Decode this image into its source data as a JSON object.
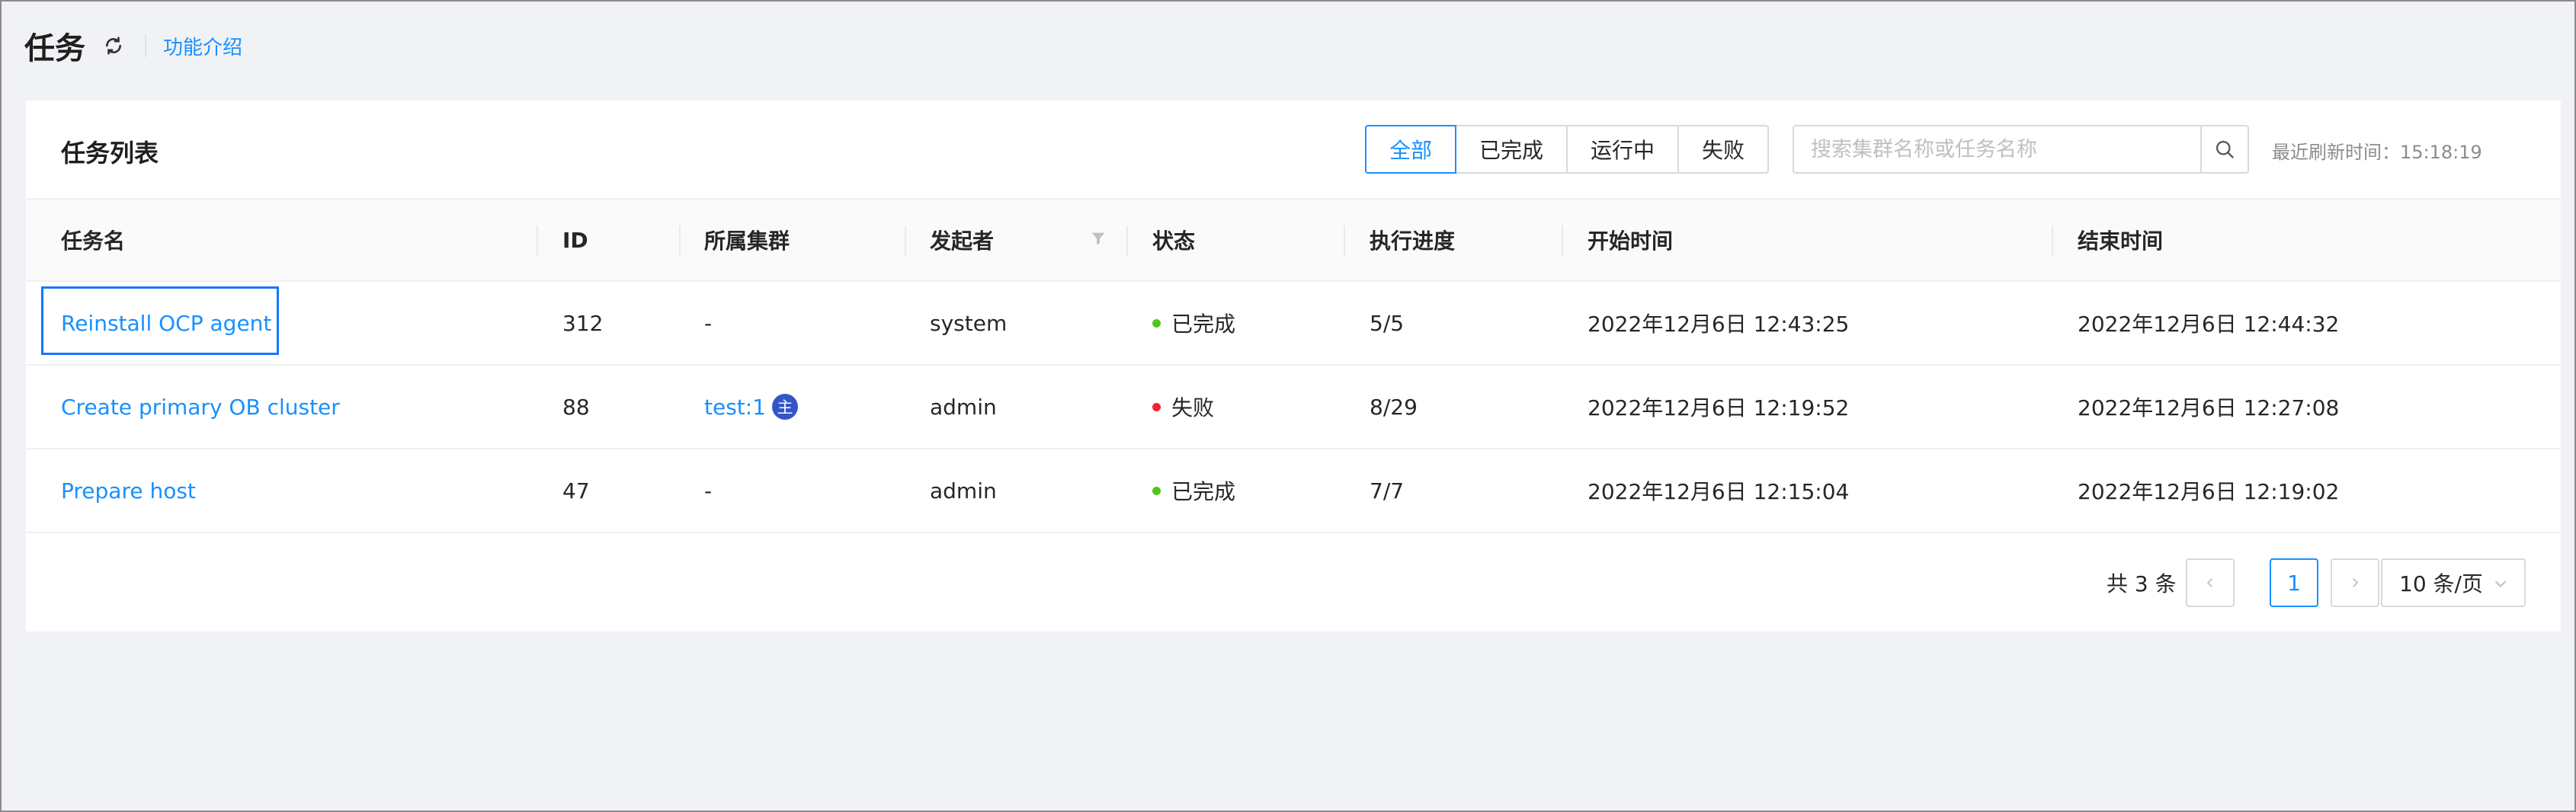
{
  "header": {
    "title": "任务",
    "refresh_icon": "refresh-icon",
    "intro_link": "功能介绍"
  },
  "card": {
    "title": "任务列表",
    "filters": [
      "全部",
      "已完成",
      "运行中",
      "失败"
    ],
    "active_filter": "全部",
    "search": {
      "placeholder": "搜索集群名称或任务名称",
      "value": ""
    },
    "refresh_time": "最近刷新时间：15:18:19"
  },
  "table": {
    "columns": [
      "任务名",
      "ID",
      "所属集群",
      "发起者",
      "状态",
      "执行进度",
      "开始时间",
      "结束时间"
    ],
    "rows": [
      {
        "name": "Reinstall OCP agent",
        "id": "312",
        "cluster": "-",
        "cluster_badge": "",
        "initiator": "system",
        "status": "已完成",
        "progress": "5/5",
        "start": "2022年12月6日 12:43:25",
        "end": "2022年12月6日 12:44:32"
      },
      {
        "name": "Create primary OB cluster",
        "id": "88",
        "cluster": "test:1",
        "cluster_badge": "主",
        "initiator": "admin",
        "status": "失败",
        "progress": "8/29",
        "start": "2022年12月6日 12:19:52",
        "end": "2022年12月6日 12:27:08"
      },
      {
        "name": "Prepare host",
        "id": "47",
        "cluster": "-",
        "cluster_badge": "",
        "initiator": "admin",
        "status": "已完成",
        "progress": "7/7",
        "start": "2022年12月6日 12:15:04",
        "end": "2022年12月6日 12:19:02"
      }
    ]
  },
  "pagination": {
    "total": "共 3 条",
    "current_page": "1",
    "page_size": "10 条/页"
  },
  "colors": {
    "primary": "#1890ff",
    "success": "#52c41a",
    "error": "#f5222d",
    "badge": "#3256c7"
  }
}
